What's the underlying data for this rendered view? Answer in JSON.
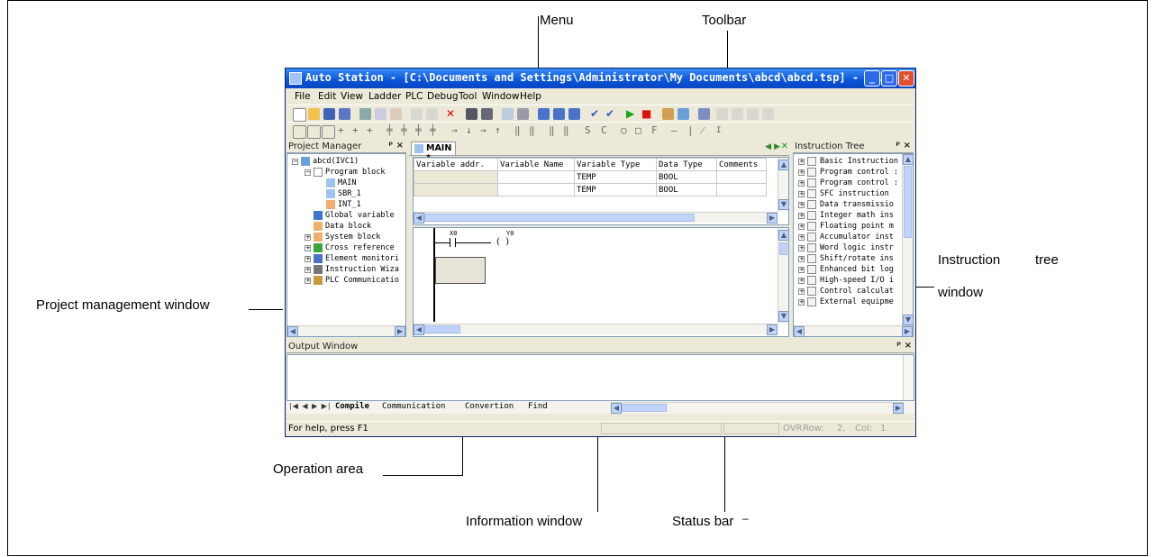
{
  "callouts": {
    "menu": "Menu",
    "toolbar": "Toolbar",
    "instruction_tree_1": "Instruction",
    "instruction_tree_2": "tree",
    "instruction_tree_3": "window",
    "project_management": "Project management window",
    "operation_area": "Operation area",
    "information_window": "Information window",
    "status_bar": "Status bar",
    "status_bar_dash": "–"
  },
  "window": {
    "title": "Auto Station - [C:\\Documents and Settings\\Administrator\\My Documents\\abcd\\abcd.tsp] - [..."
  },
  "menu": [
    "File",
    "Edit",
    "View",
    "Ladder",
    "PLC",
    "Debug",
    "Tool",
    "Window",
    "Help"
  ],
  "project_manager": {
    "title": "Project Manager",
    "pin": "ᵖ ×",
    "root": "abcd(IVC1)",
    "program_block": "Program block",
    "programs": [
      "MAIN",
      "SBR_1",
      "INT_1"
    ],
    "items": [
      "Global variable",
      "Data block",
      "System block",
      "Cross reference",
      "Element monitori",
      "Instruction Wiza",
      "PLC Communicatio"
    ]
  },
  "editor": {
    "tab": "MAIN *",
    "columns": [
      "Variable addr.",
      "Variable Name",
      "Variable Type",
      "Data Type",
      "Comments"
    ],
    "rows": [
      [
        "",
        "",
        "TEMP",
        "BOOL",
        ""
      ],
      [
        "",
        "",
        "TEMP",
        "BOOL",
        ""
      ]
    ],
    "contact": "X0",
    "coil": "Y0"
  },
  "instruction_tree": {
    "title": "Instruction Tree",
    "items": [
      "Basic Instruction",
      "Program control :",
      "Program control :",
      "SFC instruction",
      "Data transmissio",
      "Integer math ins",
      "Floating point m",
      "Accumulator inst",
      "Word logic instr",
      "Shift/rotate ins",
      "Enhanced bit log",
      "High-speed I/O i",
      "Control calculat",
      "External equipme"
    ]
  },
  "output": {
    "title": "Output Window",
    "tabs": [
      "Compile",
      "Communication",
      "Convertion",
      "Find"
    ]
  },
  "status": {
    "help": "For help, press F1",
    "ovr": "OVR",
    "row_label": "Row:",
    "row": "2,",
    "col_label": "Col:",
    "col": "1"
  }
}
